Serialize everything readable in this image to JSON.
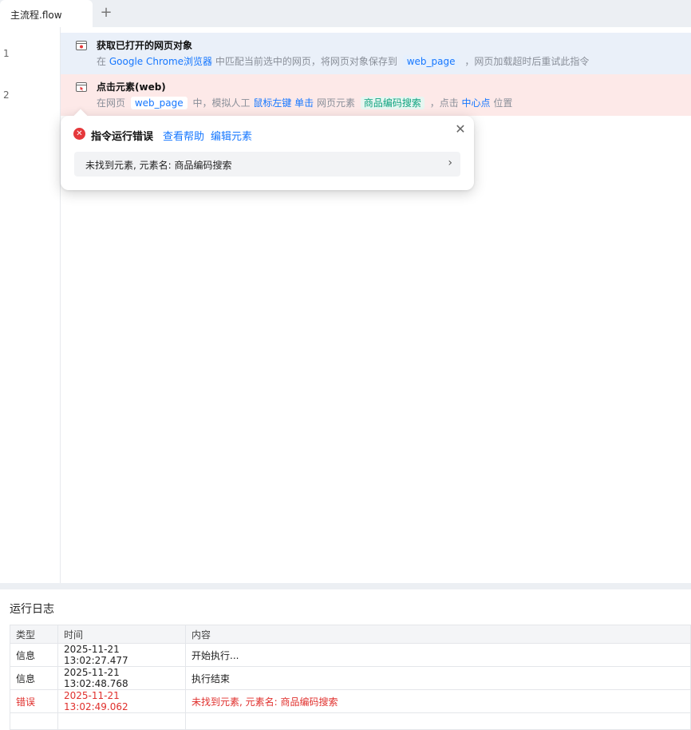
{
  "tabs": {
    "active_label": "主流程.flow",
    "add_label": "+"
  },
  "lines": [
    "1",
    "2"
  ],
  "steps": [
    {
      "title": "获取已打开的网页对象",
      "icon": "browser-icon",
      "desc": {
        "p1": "在",
        "browser": "Google Chrome浏览器",
        "p2": "中匹配当前选中的网页，将网页对象保存到",
        "var": "web_page",
        "p3": "，网页加载超时后重试此指令"
      }
    },
    {
      "title": "点击元素(web)",
      "icon": "click-element-icon",
      "desc": {
        "p1": "在网页",
        "var": "web_page",
        "p2": "中，模拟人工",
        "button": "鼠标左键",
        "click": "单击",
        "p3": "网页元素",
        "element": "商品编码搜索",
        "p4": "，点击",
        "position": "中心点",
        "p5": "位置"
      }
    }
  ],
  "error_popover": {
    "title": "指令运行错误",
    "help_link": "查看帮助",
    "edit_link": "编辑元素",
    "close": "✕",
    "message": "未找到元素, 元素名: 商品编码搜索",
    "chevron": "›"
  },
  "log": {
    "title": "运行日志",
    "columns": [
      "类型",
      "时间",
      "内容"
    ],
    "rows": [
      {
        "type": "信息",
        "time": "2025-11-21 13:02:27.477",
        "content": "开始执行..."
      },
      {
        "type": "信息",
        "time": "2025-11-21 13:02:48.768",
        "content": "执行结束"
      },
      {
        "type": "错误",
        "time": "2025-11-21 13:02:49.062",
        "content": "未找到元素, 元素名: 商品编码搜索"
      }
    ]
  },
  "colors": {
    "accent": "#1677ff",
    "error": "#e0302d",
    "step1_bg": "#eaf0f9",
    "step2_bg": "#fde9e8",
    "element_tag": "#10a37f"
  }
}
